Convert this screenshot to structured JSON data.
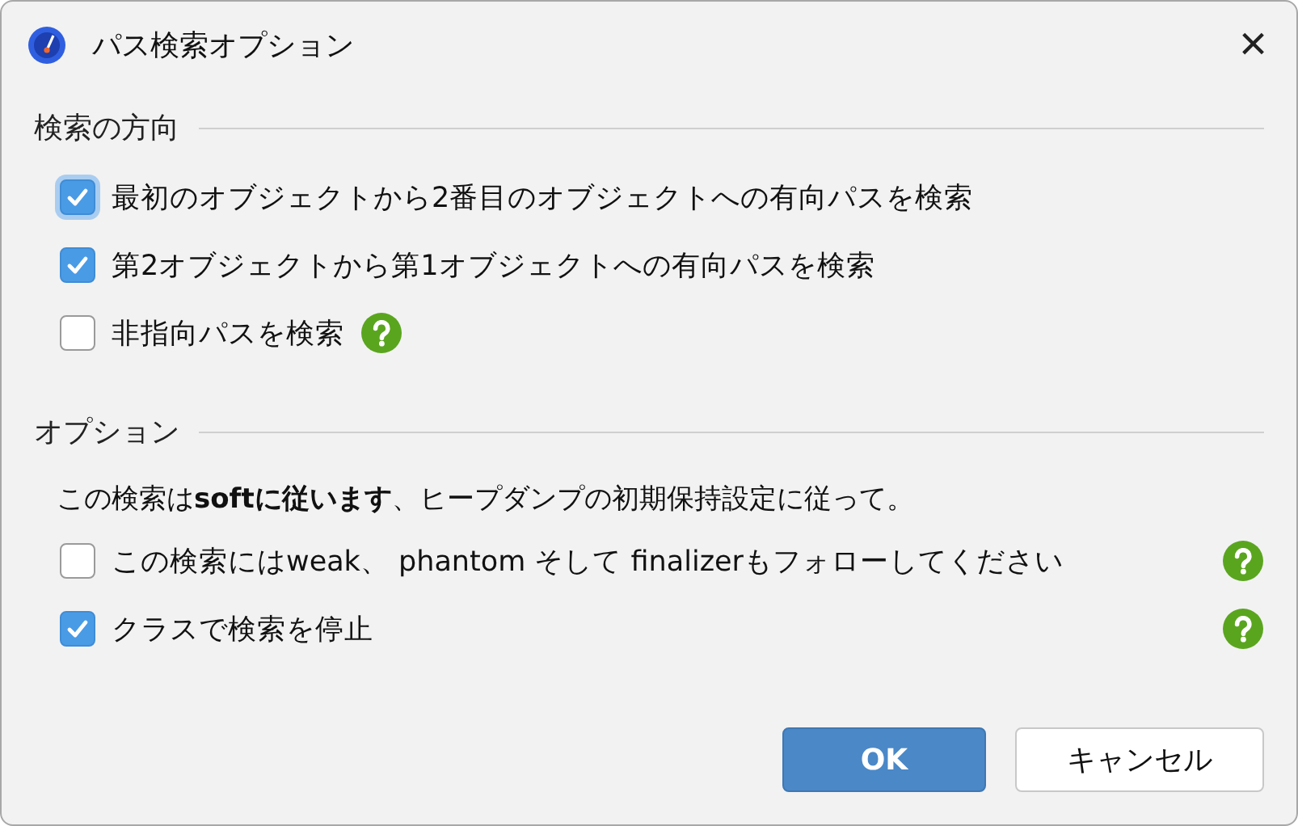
{
  "window": {
    "title": "パス検索オプション",
    "close": "×"
  },
  "sections": [
    {
      "kind": "direction",
      "title": "検索の方向",
      "items": [
        {
          "label": "最初のオブジェクトから2番目のオブジェクトへの有向パスを検索",
          "checked": true,
          "focused": true,
          "help": false
        },
        {
          "label": "第2オブジェクトから第1オブジェクトへの有向パスを検索",
          "checked": true,
          "focused": false,
          "help": false
        },
        {
          "label": "非指向パスを検索",
          "checked": false,
          "focused": false,
          "help": true
        }
      ]
    },
    {
      "kind": "options",
      "title": "オプション",
      "note": "この検索は**softに従います**、ヒープダンプの初期保持設定に従って。",
      "items": [
        {
          "label": "この検索にはweak、 phantom そして finalizerもフォローしてください",
          "checked": false,
          "focused": false,
          "help": true
        },
        {
          "label": "クラスで検索を停止",
          "checked": true,
          "focused": false,
          "help": true
        }
      ]
    }
  ],
  "buttons": [
    {
      "label": "OK",
      "kind": "primary"
    },
    {
      "label": "キャンセル",
      "kind": "secondary"
    }
  ]
}
